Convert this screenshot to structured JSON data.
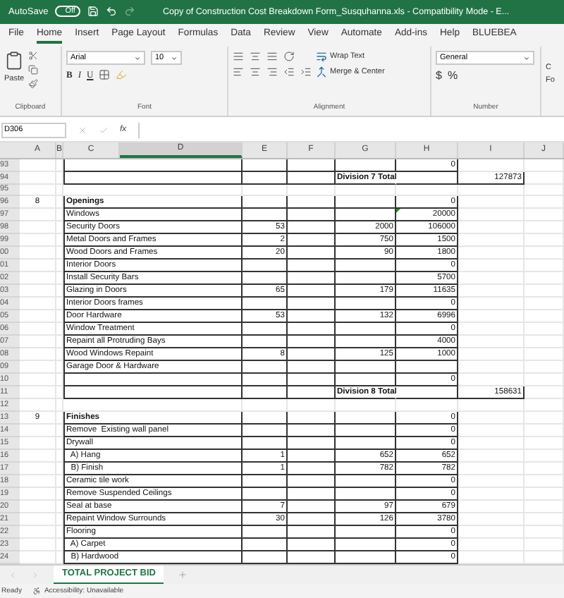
{
  "title_bar": {
    "autosave_label": "AutoSave",
    "autosave_toggle": "Off",
    "autosave_on": false,
    "title": "Copy of Construction Cost Breakdown Form_Susquhanna.xls  -  Compatibility Mode  -  E..."
  },
  "ribbon_tabs": [
    {
      "label": "File",
      "selected": false
    },
    {
      "label": "Home",
      "selected": true
    },
    {
      "label": "Insert",
      "selected": false
    },
    {
      "label": "Page Layout",
      "selected": false
    },
    {
      "label": "Formulas",
      "selected": false
    },
    {
      "label": "Data",
      "selected": false
    },
    {
      "label": "Review",
      "selected": false
    },
    {
      "label": "View",
      "selected": false
    },
    {
      "label": "Automate",
      "selected": false
    },
    {
      "label": "Add-ins",
      "selected": false
    },
    {
      "label": "Help",
      "selected": false
    },
    {
      "label": "BLUEBEA",
      "selected": false
    }
  ],
  "ribbon": {
    "paste": "Paste",
    "font_name": "Arial",
    "font_size": "10",
    "format_buttons": [
      "B",
      "I",
      "U"
    ],
    "wrap_text": "Wrap Text",
    "merge_center": "Merge & Center",
    "number_format": "General",
    "number_buttons": [
      "$",
      "%"
    ],
    "partial_button_lines": [
      "C",
      "Fo"
    ],
    "group_labels": [
      "Clipboard",
      "Font",
      "Alignment",
      "Number"
    ]
  },
  "formula_bar": {
    "name_box": "D306",
    "fx": "fx"
  },
  "columns": [
    {
      "label": "A",
      "selected": false
    },
    {
      "label": "B",
      "selected": false
    },
    {
      "label": "C",
      "selected": false
    },
    {
      "label": "D",
      "selected": true
    },
    {
      "label": "E",
      "selected": false
    },
    {
      "label": "F",
      "selected": false
    },
    {
      "label": "G",
      "selected": false
    },
    {
      "label": "H",
      "selected": false
    },
    {
      "label": "I",
      "selected": false
    },
    {
      "label": "J",
      "selected": false
    }
  ],
  "rows": [
    {
      "n": "93",
      "kind": "item",
      "h": "0"
    },
    {
      "n": "94",
      "kind": "total",
      "g": "Division 7 Total",
      "i": "127873"
    },
    {
      "n": "95",
      "kind": "gap"
    },
    {
      "n": "96",
      "kind": "section",
      "a": "8",
      "c": "Openings",
      "h": "0"
    },
    {
      "n": "97",
      "kind": "item",
      "c": "Windows",
      "h": "20000",
      "comment": true
    },
    {
      "n": "98",
      "kind": "item",
      "c": "Security Doors",
      "e": "53",
      "g": "2000",
      "h": "106000"
    },
    {
      "n": "99",
      "kind": "item",
      "c": "Metal Doors and Frames",
      "e": "2",
      "g": "750",
      "h": "1500"
    },
    {
      "n": "00",
      "kind": "item",
      "c": "Wood Doors and Frames",
      "e": "20",
      "g": "90",
      "h": "1800"
    },
    {
      "n": "01",
      "kind": "item",
      "c": "Interior Doors",
      "h": "0"
    },
    {
      "n": "02",
      "kind": "item",
      "c": "Install Security Bars",
      "h": "5700"
    },
    {
      "n": "03",
      "kind": "item",
      "c": "Glazing in Doors",
      "e": "65",
      "g": "179",
      "h": "11635"
    },
    {
      "n": "04",
      "kind": "item",
      "c": "Interior Doors frames",
      "h": "0"
    },
    {
      "n": "05",
      "kind": "item",
      "c": "Door Hardware",
      "e": "53",
      "g": "132",
      "h": "6996"
    },
    {
      "n": "06",
      "kind": "item",
      "c": "Window Treatment",
      "h": "0"
    },
    {
      "n": "07",
      "kind": "item",
      "c": "Repaint all Protruding Bays",
      "h": "4000"
    },
    {
      "n": "08",
      "kind": "item",
      "c": "Wood Windows Repaint",
      "e": "8",
      "g": "125",
      "h": "1000"
    },
    {
      "n": "09",
      "kind": "item",
      "c": "Garage Door & Hardware"
    },
    {
      "n": "10",
      "kind": "item",
      "h": "0"
    },
    {
      "n": "11",
      "kind": "total",
      "g": "Division 8 Total",
      "i": "158631"
    },
    {
      "n": "12",
      "kind": "gap"
    },
    {
      "n": "13",
      "kind": "section",
      "a": "9",
      "c": "Finishes",
      "h": "0"
    },
    {
      "n": "14",
      "kind": "item",
      "c": "Remove  Existing wall panel",
      "h": "0"
    },
    {
      "n": "15",
      "kind": "item",
      "c": "Drywall",
      "h": "0"
    },
    {
      "n": "16",
      "kind": "item",
      "c": "  A) Hang",
      "e": "1",
      "g": "652",
      "h": "652"
    },
    {
      "n": "17",
      "kind": "item",
      "c": "  B) Finish",
      "e": "1",
      "g": "782",
      "h": "782"
    },
    {
      "n": "18",
      "kind": "item",
      "c": "Ceramic tile work",
      "h": "0"
    },
    {
      "n": "19",
      "kind": "item",
      "c": "Remove Suspended Ceilings",
      "h": "0"
    },
    {
      "n": "20",
      "kind": "item",
      "c": "Seal at base",
      "e": "7",
      "g": "97",
      "h": "679"
    },
    {
      "n": "21",
      "kind": "item",
      "c": "Repaint Window Surrounds",
      "e": "30",
      "g": "126",
      "h": "3780"
    },
    {
      "n": "22",
      "kind": "item",
      "c": "Flooring",
      "h": "0"
    },
    {
      "n": "23",
      "kind": "item",
      "c": "  A) Carpet",
      "h": "0"
    },
    {
      "n": "24",
      "kind": "item",
      "c": "  B) Hardwood",
      "h": "0"
    }
  ],
  "sheet_tabs": [
    {
      "label": "TOTAL PROJECT BID",
      "selected": true
    }
  ],
  "status_bar": {
    "ready": "Ready",
    "accessibility": "Accessibility: Unavailable"
  }
}
